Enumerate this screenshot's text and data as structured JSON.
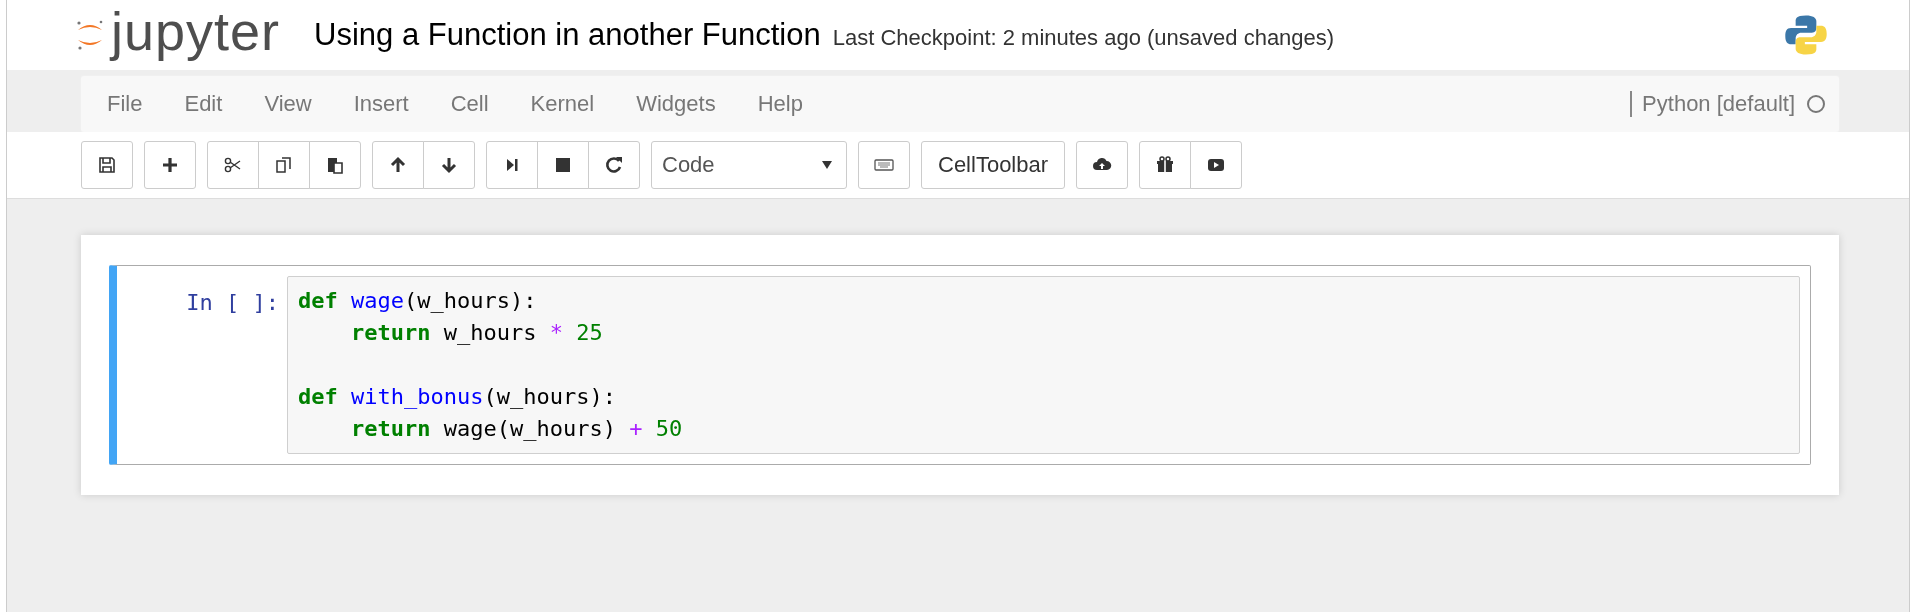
{
  "header": {
    "logo_text": "jupyter",
    "notebook_title": "Using a Function in another Function",
    "checkpoint": "Last Checkpoint: 2 minutes ago (unsaved changes)"
  },
  "menu": [
    "File",
    "Edit",
    "View",
    "Insert",
    "Cell",
    "Kernel",
    "Widgets",
    "Help"
  ],
  "kernel": {
    "name": "Python [default]",
    "busy": false
  },
  "toolbar": {
    "cell_type": "Code",
    "cell_toolbar": "CellToolbar"
  },
  "cell": {
    "prompt": "In [ ]:",
    "selected": true,
    "blocks": [
      {
        "lines": [
          [
            {
              "kind": "keyword",
              "text": "def"
            },
            {
              "kind": "name",
              "text": " wage"
            },
            {
              "kind": "plain",
              "text": "(w_hours):"
            }
          ],
          [
            {
              "kind": "keyword",
              "text": "    return"
            },
            {
              "kind": "plain",
              "text": " w_hours "
            },
            {
              "kind": "operator",
              "text": "*"
            },
            {
              "kind": "number",
              "text": " 25"
            }
          ]
        ]
      },
      {
        "lines": [
          [
            {
              "kind": "keyword",
              "text": "def"
            },
            {
              "kind": "name",
              "text": " with_bonus"
            },
            {
              "kind": "plain",
              "text": "(w_hours):"
            }
          ],
          [
            {
              "kind": "keyword",
              "text": "    return"
            },
            {
              "kind": "plain",
              "text": " wage(w_hours) "
            },
            {
              "kind": "operator",
              "text": "+"
            },
            {
              "kind": "number",
              "text": " 50"
            }
          ]
        ]
      }
    ]
  }
}
